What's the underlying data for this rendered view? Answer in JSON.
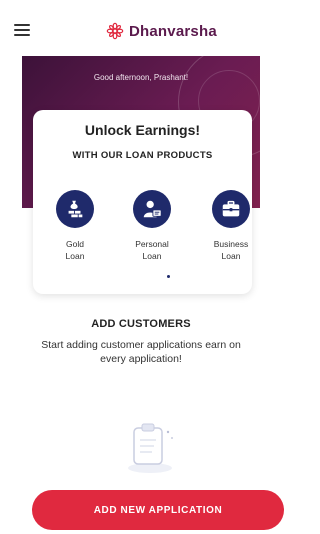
{
  "header": {
    "menu_icon": "hamburger-menu-icon",
    "logo_icon": "dhanvarsha-flower-logo",
    "brand_name": "Dhanvarsha",
    "brand_color": "#5b1a4d"
  },
  "hero": {
    "greeting": "Good afternoon, Prashant!",
    "gradient_start": "#3c1239",
    "gradient_end": "#82224f"
  },
  "promo_card": {
    "title": "Unlock Earnings!",
    "subtitle": "WITH OUR LOAN PRODUCTS",
    "products": [
      {
        "label_line1": "Gold",
        "label_line2": "Loan",
        "icon": "gold-bars-icon"
      },
      {
        "label_line1": "Personal",
        "label_line2": "Loan",
        "icon": "person-card-icon"
      },
      {
        "label_line1": "Business",
        "label_line2": "Loan",
        "icon": "briefcase-icon"
      }
    ],
    "icon_circle_color": "#1f2a6b"
  },
  "add_customers": {
    "title": "ADD CUSTOMERS",
    "description": "Start adding customer applications earn on every application!",
    "illustration_icon": "clipboard-illustration"
  },
  "cta": {
    "label": "ADD NEW APPLICATION",
    "color": "#e0293f"
  }
}
